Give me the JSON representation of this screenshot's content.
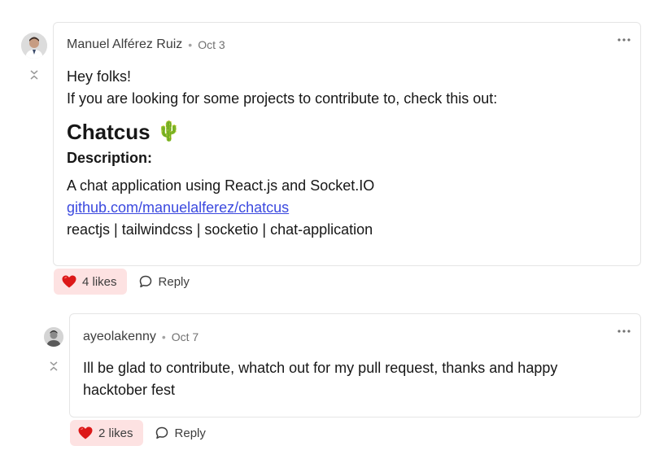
{
  "comments": [
    {
      "author": "Manuel Alférez Ruiz",
      "date": "Oct 3",
      "greeting": "Hey folks!",
      "intro": "If you are looking for some projects to contribute to, check this out:",
      "project_title": "Chatcus",
      "project_emoji": "🌵",
      "description_heading": "Description:",
      "description": "A chat application using React.js and Socket.IO",
      "link_text": "github.com/manuelalferez/chatcus",
      "tags": "reactjs | tailwindcss | socketio | chat-application",
      "likes_label": "4 likes",
      "reply_label": "Reply"
    },
    {
      "author": "ayeolakenny",
      "date": "Oct 7",
      "body_line1": "Ill be glad to contribute, whatch out for my pull request, thanks and happy",
      "body_line2": "hacktober fest",
      "likes_label": "2 likes",
      "reply_label": "Reply"
    }
  ],
  "colors": {
    "like_bg": "#fde2e2",
    "heart": "#dc1818",
    "link": "#3b49df",
    "border": "#e5e5e5"
  },
  "icons": {
    "like": "heart-icon",
    "reply": "speech-bubble-icon",
    "more": "ellipsis-icon",
    "collapse": "collapse-chevrons-icon"
  }
}
